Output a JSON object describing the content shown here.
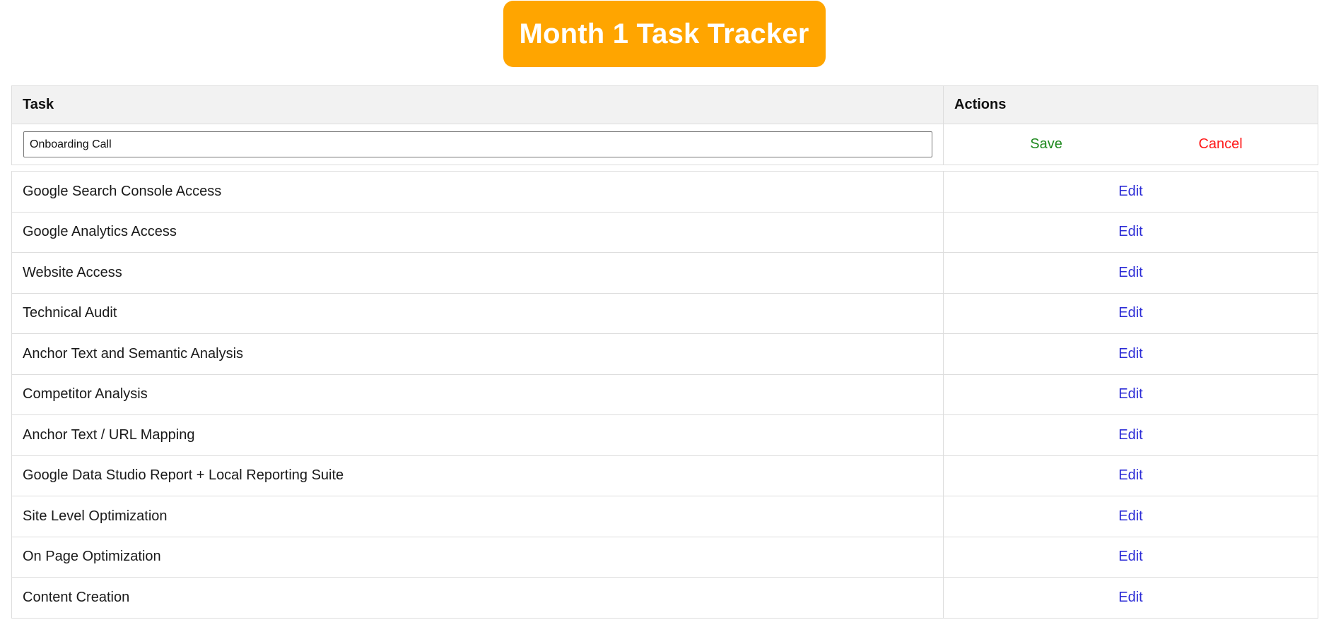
{
  "header": {
    "title": "Month 1 Task Tracker"
  },
  "table": {
    "columns": [
      "Task",
      "Actions"
    ],
    "editing_row": {
      "value": "Onboarding Call",
      "save_label": "Save",
      "cancel_label": "Cancel"
    },
    "rows": [
      {
        "task": "Google Search Console Access",
        "action": "Edit"
      },
      {
        "task": "Google Analytics Access",
        "action": "Edit"
      },
      {
        "task": "Website Access",
        "action": "Edit"
      },
      {
        "task": "Technical Audit",
        "action": "Edit"
      },
      {
        "task": "Anchor Text and Semantic Analysis",
        "action": "Edit"
      },
      {
        "task": "Competitor Analysis",
        "action": "Edit"
      },
      {
        "task": "Anchor Text / URL Mapping",
        "action": "Edit"
      },
      {
        "task": "Google Data Studio Report + Local Reporting Suite",
        "action": "Edit"
      },
      {
        "task": "Site Level Optimization",
        "action": "Edit"
      },
      {
        "task": "On Page Optimization",
        "action": "Edit"
      },
      {
        "task": "Content Creation",
        "action": "Edit"
      }
    ]
  },
  "colors": {
    "title_bg": "#ffa500",
    "title_text": "#ffffff",
    "save": "#1f8a1f",
    "cancel": "#ff1a1a",
    "edit": "#2b2bd6",
    "header_bg": "#f2f2f2",
    "border": "#dddddd"
  }
}
